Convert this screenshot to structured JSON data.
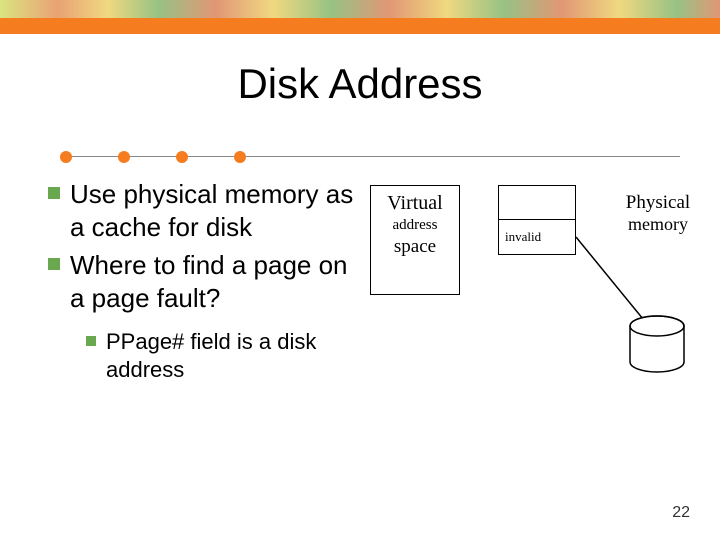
{
  "title": "Disk Address",
  "bullets": [
    "Use physical memory as a cache for disk",
    "Where to find a page on a page fault?"
  ],
  "sub_bullets": [
    "PPage# field is a disk address"
  ],
  "diagram": {
    "vas": {
      "l1": "Virtual",
      "l2": "address",
      "l3": "space"
    },
    "pt_rows": [
      "",
      "invalid"
    ],
    "pm": {
      "l1": "Physical",
      "l2": "memory"
    }
  },
  "page_number": "22"
}
